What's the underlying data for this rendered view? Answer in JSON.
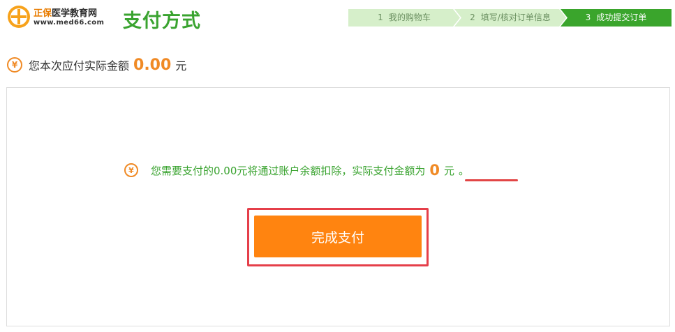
{
  "logo": {
    "brand_part1": "正保",
    "brand_part2": "医学教育网",
    "url": "www.med66.com"
  },
  "page_title": "支付方式",
  "steps": [
    {
      "num": "1",
      "label": "我的购物车",
      "active": false
    },
    {
      "num": "2",
      "label": "填写/核对订单信息",
      "active": false
    },
    {
      "num": "3",
      "label": "成功提交订单",
      "active": true
    }
  ],
  "amount": {
    "icon": "yen-icon",
    "icon_glyph": "¥",
    "label": "您本次应付实际金额",
    "value": "0.00",
    "unit": "元"
  },
  "notice": {
    "icon": "yen-icon",
    "icon_glyph": "¥",
    "text": "您需要支付的0.00元将通过账户余额扣除，实际支付金额为",
    "value": "0",
    "unit": "元",
    "end": "。"
  },
  "pay_button": {
    "label": "完成支付"
  },
  "colors": {
    "brand_green": "#39a32f",
    "accent_orange": "#ff8410",
    "highlight_red": "#e53f4a"
  }
}
